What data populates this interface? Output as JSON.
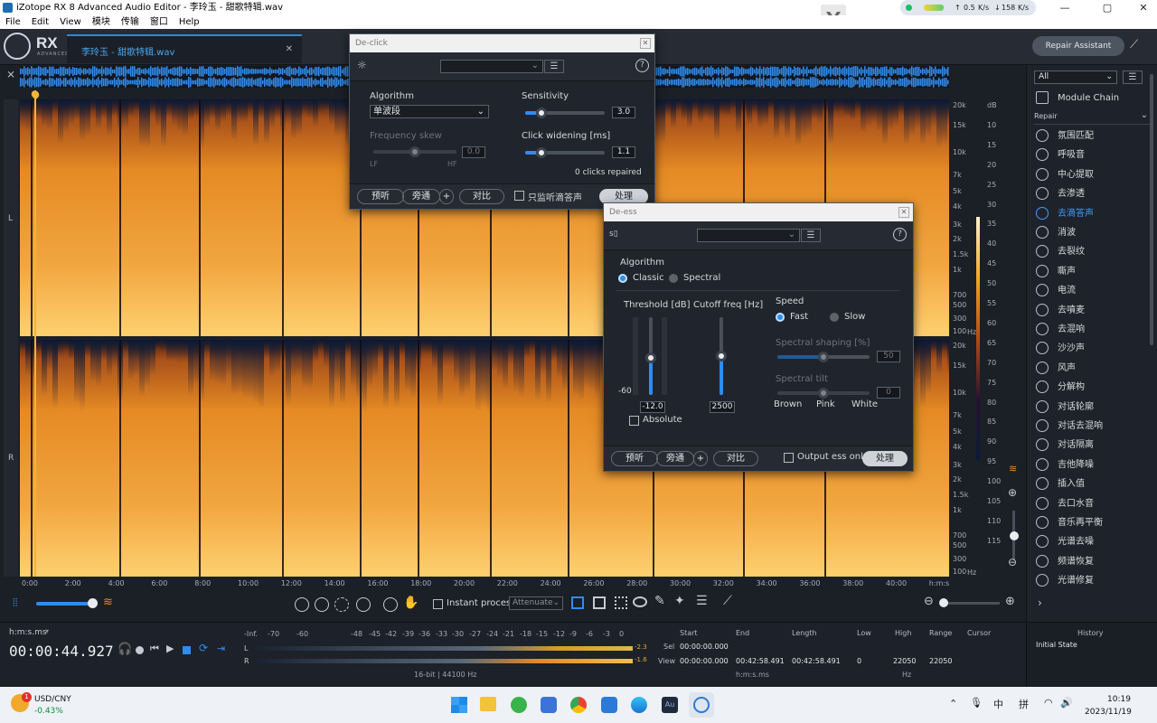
{
  "window": {
    "title": "iZotope RX 8 Advanced Audio Editor - 李玲玉 - 甜歌特辑.wav",
    "minimize": "—",
    "maximize": "▢",
    "close": "✕"
  },
  "net": {
    "up": "0.5",
    "up_unit": "K/s",
    "down": "158",
    "down_unit": "K/s"
  },
  "menu": [
    "File",
    "Edit",
    "View",
    "模块",
    "传输",
    "窗口",
    "Help"
  ],
  "brand": {
    "name": "RX",
    "sub": "ADVANCED"
  },
  "file_tab": {
    "label": "李玲玉 - 甜歌特辑.wav",
    "close": "✕"
  },
  "repair_assistant": "Repair Assistant",
  "channels": {
    "left": "L",
    "right": "R"
  },
  "freq_ticks": [
    "20k",
    "15k",
    "10k",
    "7k",
    "5k",
    "4k",
    "3k",
    "2k",
    "1.5k",
    "1k",
    "700",
    "500",
    "300",
    "100"
  ],
  "freq_unit": "Hz",
  "db_ticks": [
    "dB",
    "10",
    "15",
    "20",
    "25",
    "30",
    "35",
    "40",
    "45",
    "50",
    "55",
    "60",
    "65",
    "70",
    "75",
    "80",
    "85",
    "90",
    "95",
    "100",
    "105",
    "110",
    "115"
  ],
  "time_ticks": [
    "0:00",
    "2:00",
    "4:00",
    "6:00",
    "8:00",
    "10:00",
    "12:00",
    "14:00",
    "16:00",
    "18:00",
    "20:00",
    "22:00",
    "24:00",
    "26:00",
    "28:00",
    "30:00",
    "32:00",
    "34:00",
    "36:00",
    "38:00",
    "40:00",
    "h:m:s"
  ],
  "toolbar": {
    "instant_process": "Instant process",
    "attenuate": "Attenuate"
  },
  "transport": {
    "format": "h:m:s.ms",
    "time": "00:00:44.927"
  },
  "meter": {
    "scale": [
      "-Inf.",
      "-70",
      "-60",
      "-48",
      "-45",
      "-42",
      "-39",
      "-36",
      "-33",
      "-30",
      "-27",
      "-24",
      "-21",
      "-18",
      "-15",
      "-12",
      "-9",
      "-6",
      "-3",
      "0"
    ],
    "left_label": "L",
    "right_label": "R",
    "left_peak": "-2.3",
    "right_peak": "-1.6",
    "format": "16-bit | 44100 Hz"
  },
  "selection": {
    "start_h": "Start",
    "end_h": "End",
    "length_h": "Length",
    "low_h": "Low",
    "high_h": "High",
    "range_h": "Range",
    "cursor_h": "Cursor",
    "sel": "Sel",
    "view": "View",
    "sel_start": "00:00:00.000",
    "view_start": "00:00:00.000",
    "view_end": "00:42:58.491",
    "view_length": "00:42:58.491",
    "low": "0",
    "high": "22050",
    "range": "22050",
    "time_unit": "h:m:s.ms",
    "freq_unit": "Hz"
  },
  "history": {
    "title": "History",
    "item": "Initial State"
  },
  "panel": {
    "filter": "All",
    "chain": "Module Chain",
    "group": "Repair",
    "modules": [
      "氛围匹配",
      "呼吸音",
      "中心提取",
      "去渗透",
      "去滴答声",
      "消波",
      "去裂纹",
      "嘶声",
      "电流",
      "去噴麦",
      "去混响",
      "沙沙声",
      "风声",
      "分解构",
      "对话轮廓",
      "对话去混响",
      "对话隔离",
      "吉他降噪",
      "插入值",
      "去口水音",
      "音乐再平衡",
      "光谱去噪",
      "频谱恢复",
      "光谱修复"
    ],
    "selected": 4
  },
  "declick": {
    "title": "De-click",
    "close": "✕",
    "algorithm_label": "Algorithm",
    "algorithm_value": "单波段",
    "sensitivity_label": "Sensitivity",
    "sensitivity_value": "3.0",
    "sensitivity_frac": 0.2,
    "freq_skew_label": "Frequency skew",
    "freq_skew_value": "0.0",
    "freq_skew_frac": 0.5,
    "lf": "LF",
    "hf": "HF",
    "widening_label": "Click widening [ms]",
    "widening_value": "1.1",
    "widening_frac": 0.2,
    "status": "0 clicks repaired",
    "preview": "预听",
    "bypass": "旁通",
    "plus": "+",
    "compare": "对比",
    "monitor": "只监听滴答声",
    "process": "处理"
  },
  "deess": {
    "title": "De-ess",
    "close": "✕",
    "algorithm_label": "Algorithm",
    "classic": "Classic",
    "spectral": "Spectral",
    "threshold_label": "Threshold [dB]",
    "threshold_min": "-60",
    "threshold_value": "-12.0",
    "threshold_frac": 0.8,
    "cutoff_label": "Cutoff freq [Hz]",
    "cutoff_value": "2500",
    "cutoff_frac": 0.5,
    "absolute": "Absolute",
    "speed_label": "Speed",
    "fast": "Fast",
    "slow": "Slow",
    "shaping_label": "Spectral shaping [%]",
    "shaping_value": "50",
    "shaping_frac": 0.5,
    "tilt_label": "Spectral tilt",
    "tilt_value": "0",
    "tilt_frac": 0.5,
    "brown": "Brown",
    "pink": "Pink",
    "white": "White",
    "preview": "预听",
    "bypass": "旁通",
    "plus": "+",
    "compare": "对比",
    "output_ess": "Output ess only",
    "process": "处理"
  },
  "taskbar": {
    "ticker": "USD/CNY",
    "change": "-0.43%",
    "badge": "1",
    "ime_lang": "中",
    "ime_mode": "拼",
    "time": "10:19",
    "date": "2023/11/19",
    "au_label": "Au"
  },
  "colors": {
    "accent": "#2f8cf0",
    "spectrogram_hot": "#f0a020",
    "spectrogram_dark": "#0a1a30"
  }
}
